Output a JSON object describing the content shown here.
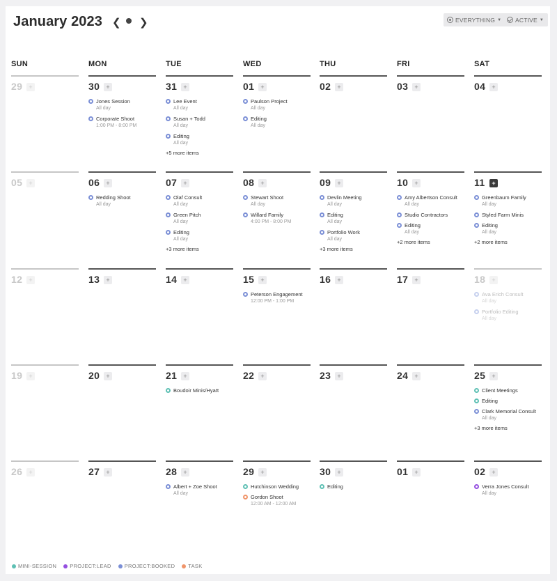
{
  "header": {
    "title": "January 2023",
    "filter_everything": "EVERYTHING",
    "filter_active": "ACTIVE"
  },
  "days_of_week": [
    "SUN",
    "MON",
    "TUE",
    "WED",
    "THU",
    "FRI",
    "SAT"
  ],
  "weeks": [
    [
      {
        "day": "29",
        "muted": true,
        "events": []
      },
      {
        "day": "30",
        "events": [
          {
            "name": "Jones Session",
            "sub": "All day",
            "type": "booked"
          },
          {
            "name": "Corporate Shoot",
            "sub": "1:00 PM - 8:00 PM",
            "type": "booked"
          }
        ]
      },
      {
        "day": "31",
        "events": [
          {
            "name": "Lee Event",
            "sub": "All day",
            "type": "booked"
          },
          {
            "name": "Susan + Todd",
            "sub": "All day",
            "type": "booked"
          },
          {
            "name": "Editing",
            "sub": "All day",
            "type": "booked"
          }
        ],
        "more": "+5 more items"
      },
      {
        "day": "01",
        "events": [
          {
            "name": "Paulson Project",
            "sub": "All day",
            "type": "booked"
          },
          {
            "name": "Editing",
            "sub": "All day",
            "type": "booked"
          }
        ]
      },
      {
        "day": "02",
        "events": []
      },
      {
        "day": "03",
        "events": []
      },
      {
        "day": "04",
        "events": []
      }
    ],
    [
      {
        "day": "05",
        "muted": true,
        "events": []
      },
      {
        "day": "06",
        "events": [
          {
            "name": "Redding Shoot",
            "sub": "All day",
            "type": "booked"
          }
        ]
      },
      {
        "day": "07",
        "events": [
          {
            "name": "Olaf Consult",
            "sub": "All day",
            "type": "booked"
          },
          {
            "name": "Green Pitch",
            "sub": "All day",
            "type": "booked"
          },
          {
            "name": "Editing",
            "sub": "All day",
            "type": "booked"
          }
        ],
        "more": "+3 more items"
      },
      {
        "day": "08",
        "events": [
          {
            "name": "Stewart Shoot",
            "sub": "All day",
            "type": "booked"
          },
          {
            "name": "Willard Family",
            "sub": "4:00 PM - 8:00 PM",
            "type": "booked"
          }
        ]
      },
      {
        "day": "09",
        "events": [
          {
            "name": "Devlin Meeting",
            "sub": "All day",
            "type": "booked"
          },
          {
            "name": "Editing",
            "sub": "All day",
            "type": "booked"
          },
          {
            "name": "Portfolio Work",
            "sub": "All day",
            "type": "booked"
          }
        ],
        "more": "+3 more items"
      },
      {
        "day": "10",
        "events": [
          {
            "name": "Amy Albertson Consult",
            "sub": "All day",
            "type": "booked"
          },
          {
            "name": "Studio Contractors",
            "sub": "",
            "type": "booked"
          },
          {
            "name": "Editing",
            "sub": "All day",
            "type": "booked"
          }
        ],
        "more": "+2 more items"
      },
      {
        "day": "11",
        "today": true,
        "events": [
          {
            "name": "Greenbaum Family",
            "sub": "All day",
            "type": "booked"
          },
          {
            "name": "Styled Farm Minis",
            "sub": "",
            "type": "booked"
          },
          {
            "name": "Editing",
            "sub": "All day",
            "type": "booked"
          }
        ],
        "more": "+2 more items"
      }
    ],
    [
      {
        "day": "12",
        "muted": true,
        "events": []
      },
      {
        "day": "13",
        "events": []
      },
      {
        "day": "14",
        "events": []
      },
      {
        "day": "15",
        "events": [
          {
            "name": "Peterson Engagement",
            "sub": "12:00 PM - 1:00 PM",
            "type": "booked"
          }
        ]
      },
      {
        "day": "16",
        "events": []
      },
      {
        "day": "17",
        "events": []
      },
      {
        "day": "18",
        "muted": true,
        "events": [
          {
            "name": "Ava Erich Consult",
            "sub": "All day",
            "type": "booked",
            "faded": true
          },
          {
            "name": "Portfolio Editing",
            "sub": "All day",
            "type": "booked",
            "faded": true
          }
        ]
      }
    ],
    [
      {
        "day": "19",
        "muted": true,
        "events": []
      },
      {
        "day": "20",
        "events": []
      },
      {
        "day": "21",
        "events": [
          {
            "name": "Boudoir Minis/Hyatt",
            "sub": "",
            "type": "mini"
          }
        ]
      },
      {
        "day": "22",
        "events": []
      },
      {
        "day": "23",
        "events": []
      },
      {
        "day": "24",
        "events": []
      },
      {
        "day": "25",
        "events": [
          {
            "name": "Client Meetings",
            "sub": "",
            "type": "mini"
          },
          {
            "name": "Editing",
            "sub": "",
            "type": "mini"
          },
          {
            "name": "Clark Memorial Consult",
            "sub": "All day",
            "type": "booked"
          }
        ],
        "more": "+3 more items"
      }
    ],
    [
      {
        "day": "26",
        "muted": true,
        "events": []
      },
      {
        "day": "27",
        "events": []
      },
      {
        "day": "28",
        "events": [
          {
            "name": "Albert + Zoe Shoot",
            "sub": "All day",
            "type": "booked"
          }
        ]
      },
      {
        "day": "29",
        "events": [
          {
            "name": "Hutchinson Wedding",
            "sub": "",
            "type": "mini"
          },
          {
            "name": "Gordon Shoot",
            "sub": "12:00 AM - 12:00 AM",
            "type": "task"
          }
        ]
      },
      {
        "day": "30",
        "events": [
          {
            "name": "Editing",
            "sub": "",
            "type": "mini"
          }
        ]
      },
      {
        "day": "01",
        "events": []
      },
      {
        "day": "02",
        "events": [
          {
            "name": "Verra Jones Consult",
            "sub": "All day",
            "type": "lead"
          }
        ]
      }
    ]
  ],
  "legend": [
    {
      "label": "MINI-SESSION",
      "color": "#5ec0b4"
    },
    {
      "label": "PROJECT:LEAD",
      "color": "#9550e0"
    },
    {
      "label": "PROJECT:BOOKED",
      "color": "#7b8fd6"
    },
    {
      "label": "TASK",
      "color": "#f0956a"
    }
  ],
  "colors": {
    "booked": "#7b8fd6",
    "mini": "#5ec0b4",
    "lead": "#9550e0",
    "task": "#f0956a"
  }
}
